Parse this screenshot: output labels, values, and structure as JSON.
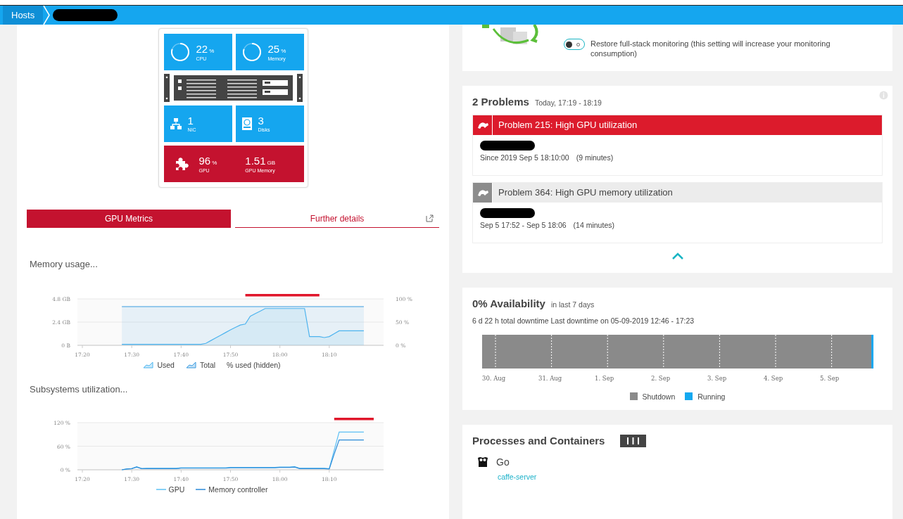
{
  "breadcrumb": {
    "items": [
      {
        "label": "Hosts"
      }
    ]
  },
  "server": {
    "tiles": [
      {
        "kind": "ring",
        "value": "22",
        "unit": "%",
        "label": "CPU"
      },
      {
        "kind": "ring",
        "value": "25",
        "unit": "%",
        "label": "Memory"
      },
      {
        "kind": "rack"
      },
      {
        "kind": "nic",
        "value": "1",
        "label": "NIC"
      },
      {
        "kind": "disk",
        "value": "3",
        "label": "Disks"
      },
      {
        "kind": "gpu",
        "value": "96",
        "unit": "%",
        "label": "GPU",
        "value2": "1.51",
        "unit2": "GB",
        "label2": "GPU Memory"
      }
    ]
  },
  "tabs": [
    {
      "label": "GPU Metrics",
      "selected": true
    },
    {
      "label": "Further details",
      "selected": false
    }
  ],
  "memory_chart": {
    "title": "Memory usage...",
    "right_axis_labels": [
      "100 %",
      "50 %",
      "0 %"
    ],
    "chart_data": {
      "type": "area",
      "categories": [
        "17:20",
        null,
        null,
        null,
        null,
        null,
        null,
        null,
        null,
        null,
        "17:30",
        null,
        null,
        null,
        null,
        null,
        null,
        null,
        null,
        null,
        "17:40",
        null,
        null,
        null,
        null,
        null,
        null,
        null,
        null,
        null,
        "17:50",
        null,
        null,
        null,
        null,
        null,
        null,
        null,
        null,
        null,
        "18:00",
        null,
        null,
        null,
        null,
        null,
        null,
        null,
        null,
        null,
        "18:10",
        null,
        null,
        null,
        null,
        null,
        null,
        null
      ],
      "yticks": [
        {
          "value": 0,
          "label": "0 B"
        },
        {
          "value": 2.4,
          "label": "2.4 GB"
        },
        {
          "value": 4.8,
          "label": "4.8 GB"
        }
      ],
      "ylim": [
        0,
        4.8
      ],
      "series": [
        {
          "name": "Used",
          "color": "#4fb6f0",
          "values": [
            null,
            null,
            null,
            null,
            null,
            null,
            null,
            null,
            0.1,
            0.1,
            0.1,
            0.1,
            0.1,
            0.1,
            0.1,
            0.1,
            0.1,
            0.1,
            0.1,
            0.1,
            0.1,
            0.1,
            0.1,
            0.1,
            0.1,
            0.2,
            0.48,
            0.76,
            1.04,
            1.32,
            1.6,
            1.85,
            2.1,
            2.2,
            3.0,
            3.27,
            3.53,
            3.8,
            3.8,
            3.8,
            3.8,
            3.8,
            3.8,
            3.8,
            3.8,
            3.8,
            0.9,
            0.9,
            0.9,
            0.8,
            0.9,
            1.2,
            1.5,
            1.5,
            1.5,
            1.5,
            1.5,
            1.5
          ]
        },
        {
          "name": "Total",
          "color": "#3a9be0",
          "values": [
            null,
            null,
            null,
            null,
            null,
            null,
            null,
            null,
            4.0,
            4.0,
            4.0,
            4.0,
            4.0,
            4.0,
            4.0,
            4.0,
            4.0,
            4.0,
            4.0,
            4.0,
            4.0,
            4.0,
            4.0,
            4.0,
            4.0,
            4.0,
            4.0,
            4.0,
            4.0,
            4.0,
            4.0,
            4.0,
            4.0,
            4.0,
            4.0,
            4.0,
            4.0,
            4.0,
            4.0,
            4.0,
            4.0,
            4.0,
            4.0,
            4.0,
            4.0,
            4.0,
            4.0,
            4.0,
            4.0,
            4.0,
            4.0,
            4.0,
            4.0,
            4.0,
            4.0,
            4.0,
            4.0,
            4.0
          ]
        },
        {
          "name": "% used (hidden)",
          "values": [
            null,
            null,
            null,
            null,
            null,
            null,
            null,
            null,
            null,
            null,
            null,
            null,
            null,
            null,
            null,
            null,
            null,
            null,
            null,
            null,
            null,
            null,
            null,
            null,
            null,
            null,
            null,
            null,
            null,
            null,
            null,
            null,
            null,
            null,
            null,
            null,
            null,
            null,
            null,
            null,
            null,
            null,
            null,
            null,
            null,
            null,
            null,
            null,
            null,
            null,
            null,
            null,
            null,
            null,
            null,
            null,
            null,
            null
          ]
        }
      ]
    }
  },
  "subsystems_chart": {
    "title": "Subsystems utilization...",
    "chart_data": {
      "type": "line",
      "categories": [
        "17:20",
        null,
        null,
        null,
        null,
        null,
        null,
        null,
        null,
        null,
        "17:30",
        null,
        null,
        null,
        null,
        null,
        null,
        null,
        null,
        null,
        "17:40",
        null,
        null,
        null,
        null,
        null,
        null,
        null,
        null,
        null,
        "17:50",
        null,
        null,
        null,
        null,
        null,
        null,
        null,
        null,
        null,
        "18:00",
        null,
        null,
        null,
        null,
        null,
        null,
        null,
        null,
        null,
        "18:10",
        null,
        null,
        null,
        null,
        null,
        null,
        null
      ],
      "yticks": [
        {
          "value": 0,
          "label": "0 %"
        },
        {
          "value": 60,
          "label": "60 %"
        },
        {
          "value": 120,
          "label": "120 %"
        }
      ],
      "ylim": [
        0,
        120
      ],
      "series": [
        {
          "name": "GPU",
          "color": "#5cc0f5",
          "values": [
            null,
            null,
            null,
            null,
            null,
            null,
            null,
            null,
            0,
            2,
            3,
            8,
            3,
            4,
            4,
            4,
            4,
            4,
            4,
            4,
            5,
            5,
            5,
            5,
            5,
            5,
            5,
            5,
            5,
            5,
            6,
            6,
            6,
            6,
            6,
            6,
            6,
            6,
            6,
            6,
            7,
            7,
            7,
            8,
            4,
            4,
            4,
            4,
            4,
            4,
            3,
            50,
            96,
            96,
            96,
            96,
            96,
            96
          ]
        },
        {
          "name": "Memory controller",
          "color": "#2a8ad8",
          "values": [
            null,
            null,
            null,
            null,
            null,
            null,
            null,
            null,
            0,
            2,
            3,
            7,
            3,
            3,
            3,
            3,
            3,
            3,
            3,
            3,
            4,
            4,
            4,
            4,
            4,
            4,
            4,
            4,
            4,
            4,
            5,
            5,
            5,
            5,
            5,
            5,
            5,
            5,
            5,
            5,
            6,
            6,
            6,
            7,
            3,
            3,
            3,
            3,
            3,
            3,
            2,
            40,
            76,
            76,
            76,
            76,
            76,
            76
          ]
        }
      ]
    }
  },
  "monitoring": {
    "toggle": {
      "on": false,
      "label": "Restore full-stack monitoring (this setting will increase your monitoring consumption)"
    }
  },
  "problems": {
    "title": "2 Problems",
    "range": "Today, 17:19 - 18:19",
    "items": [
      {
        "title": "Problem 215: High GPU utilization",
        "time": "Since 2019 Sep 5 18:10:00",
        "duration": "(9 minutes)",
        "active": true
      },
      {
        "title": "Problem 364: High GPU memory utilization",
        "time": "Sep 5 17:52 - Sep 5 18:06",
        "duration": "(14 minutes)",
        "active": false
      }
    ]
  },
  "availability": {
    "value": "0% Availability",
    "period": "in last 7 days",
    "summary": "6 d 22 h total downtime Last downtime on 05-09-2019 12:46 - 17:23",
    "days": [
      "30. Aug",
      "31. Aug",
      "1. Sep",
      "2. Sep",
      "3. Sep",
      "4. Sep",
      "5. Sep"
    ],
    "legend": [
      {
        "label": "Shutdown",
        "color": "#8a8a8a"
      },
      {
        "label": "Running",
        "color": "#14a8f0"
      }
    ]
  },
  "processes": {
    "title": "Processes and Containers",
    "groups": [
      {
        "name": "Go",
        "processes": [
          "caffe-server"
        ]
      }
    ]
  }
}
